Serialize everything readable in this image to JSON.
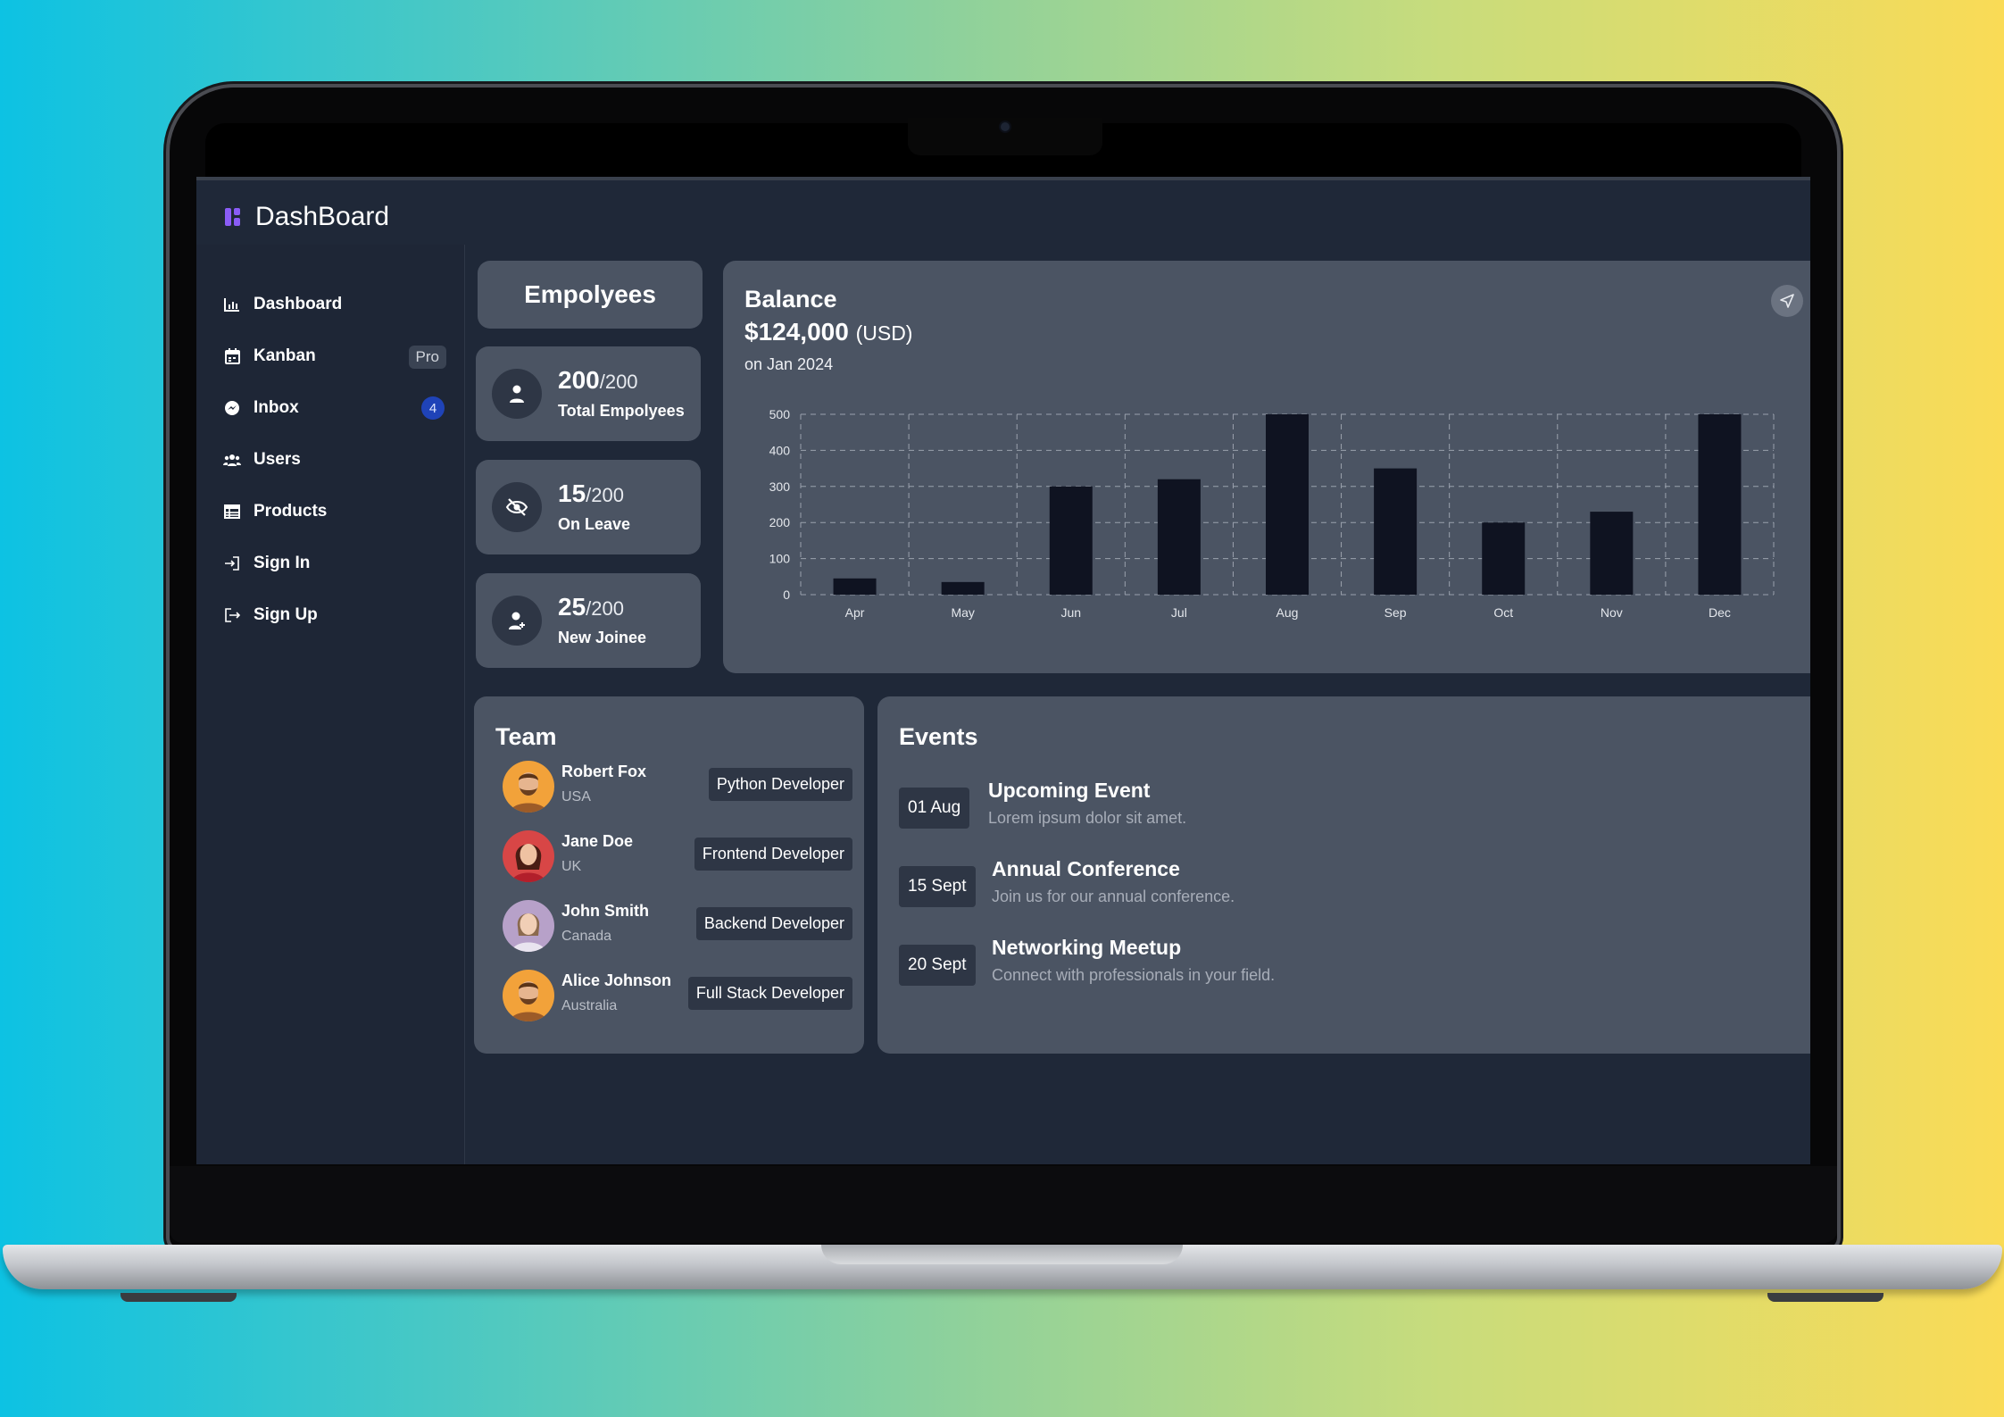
{
  "app": {
    "brand_title": "DashBoard"
  },
  "sidebar": {
    "items": [
      {
        "label": "Dashboard",
        "icon": "bar-chart-icon"
      },
      {
        "label": "Kanban",
        "icon": "calendar-icon",
        "badge": "Pro"
      },
      {
        "label": "Inbox",
        "icon": "messenger-icon",
        "badge": "4"
      },
      {
        "label": "Users",
        "icon": "users-icon"
      },
      {
        "label": "Products",
        "icon": "table-icon"
      },
      {
        "label": "Sign In",
        "icon": "sign-in-icon"
      },
      {
        "label": "Sign Up",
        "icon": "sign-out-icon"
      }
    ]
  },
  "employees": {
    "title": "Empolyees",
    "stats": [
      {
        "value": "200",
        "of": "/200",
        "label": "Total Empolyees",
        "icon": "user-icon"
      },
      {
        "value": "15",
        "of": "/200",
        "label": "On Leave",
        "icon": "eye-off-icon"
      },
      {
        "value": "25",
        "of": "/200",
        "label": "New Joinee",
        "icon": "user-plus-icon"
      }
    ]
  },
  "balance": {
    "title": "Balance",
    "amount": "$124,000",
    "currency": "(USD)",
    "date": "on Jan 2024",
    "action_icon": "send-icon"
  },
  "chart_data": {
    "type": "bar",
    "categories": [
      "Apr",
      "May",
      "Jun",
      "Jul",
      "Aug",
      "Sep",
      "Oct",
      "Nov",
      "Dec"
    ],
    "values": [
      45,
      35,
      300,
      320,
      500,
      350,
      200,
      230,
      500
    ],
    "yticks": [
      0,
      100,
      200,
      300,
      400,
      500
    ],
    "ylim": [
      0,
      500
    ],
    "grid": true,
    "bar_color": "#0f1321"
  },
  "team": {
    "title": "Team",
    "members": [
      {
        "name": "Robert Fox",
        "country": "USA",
        "role": "Python Developer"
      },
      {
        "name": "Jane Doe",
        "country": "UK",
        "role": "Frontend Developer"
      },
      {
        "name": "John Smith",
        "country": "Canada",
        "role": "Backend Developer"
      },
      {
        "name": "Alice Johnson",
        "country": "Australia",
        "role": "Full Stack Developer"
      }
    ]
  },
  "events": {
    "title": "Events",
    "items": [
      {
        "date": "01 Aug",
        "title": "Upcoming Event",
        "desc": "Lorem ipsum dolor sit amet."
      },
      {
        "date": "15 Sept",
        "title": "Annual Conference",
        "desc": "Join us for our annual conference."
      },
      {
        "date": "20 Sept",
        "title": "Networking Meetup",
        "desc": "Connect with professionals in your field."
      }
    ]
  },
  "colors": {
    "screen_bg": "#1f2838",
    "panel_bg": "#4b5463",
    "accent_brand": "#8a5cf6",
    "badge_blue": "#1f43b8"
  }
}
